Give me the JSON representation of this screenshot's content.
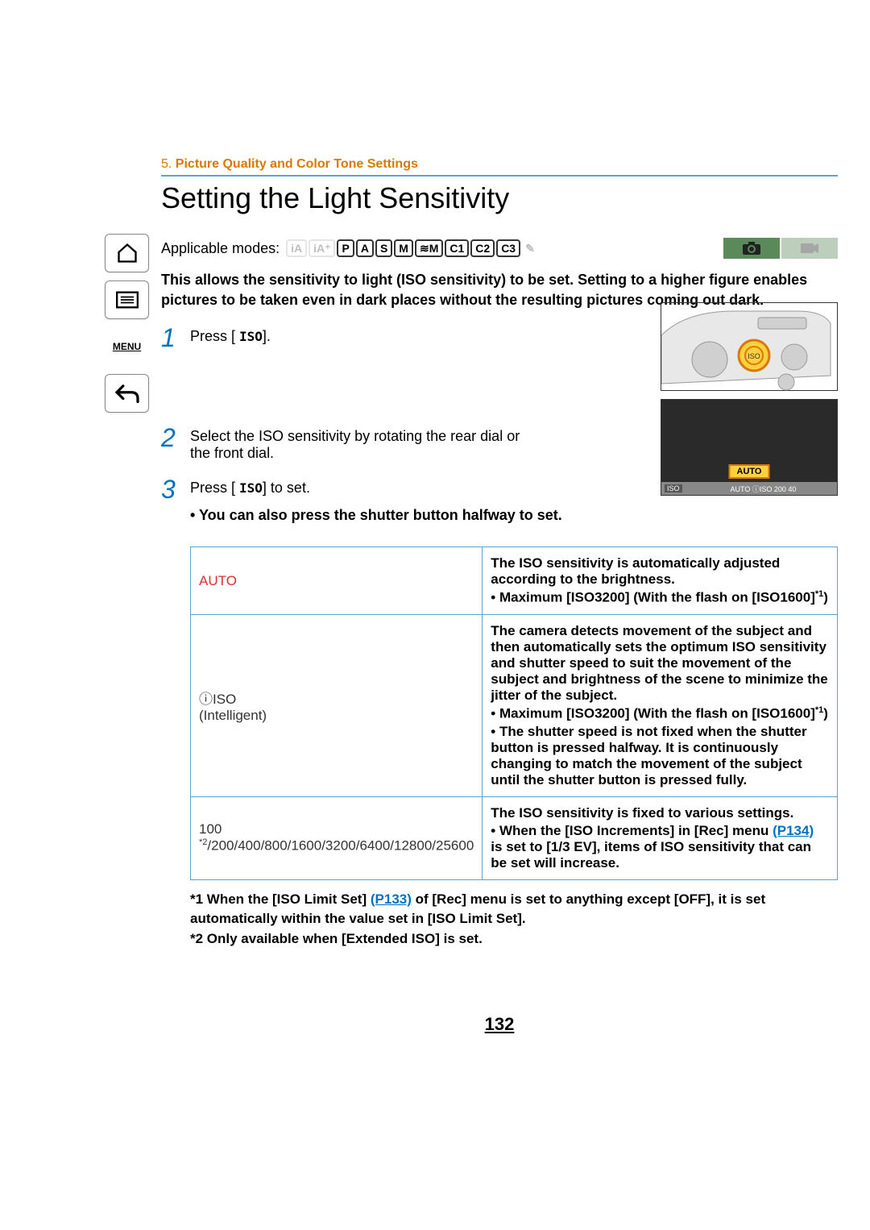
{
  "breadcrumb": {
    "num": "5.",
    "text": "Picture Quality and Color Tone Settings"
  },
  "title": "Setting the Light Sensitivity",
  "modes_label": "Applicable modes:",
  "modes": {
    "greyed_pre": [
      "iA",
      "iA+"
    ],
    "active": [
      "P",
      "A",
      "S",
      "M",
      "≋M",
      "C1",
      "C2",
      "C3"
    ],
    "greyed_post": [
      "☺"
    ]
  },
  "intro": "This allows the sensitivity to light (ISO sensitivity) to be set. Setting to a higher figure enables pictures to be taken even in dark places without the resulting pictures coming out dark.",
  "steps": {
    "s1": {
      "num": "1",
      "text_a": "Press [ ",
      "iso": "ISO",
      "text_b": "]."
    },
    "s2": {
      "num": "2",
      "text": "Select the ISO sensitivity by rotating the rear dial or the front dial."
    },
    "s3": {
      "num": "3",
      "text_a": "Press [ ",
      "iso": "ISO",
      "text_b": "] to set.",
      "sub": "You can also press the shutter button halfway to set."
    }
  },
  "screen": {
    "auto": "AUTO",
    "strip_left": "ISO",
    "strip_right": "AUTO  ⓘISO  200  40"
  },
  "table": {
    "r1": {
      "label": "AUTO",
      "desc": "The ISO sensitivity is automatically adjusted according to the brightness.",
      "b1_a": "Maximum [ISO3200] (With the flash on [ISO1600]",
      "b1_b": ")"
    },
    "r2": {
      "label_icon": "ⓘISO",
      "label_sub": "(Intelligent)",
      "desc": "The camera detects movement of the subject and then automatically sets the optimum ISO sensitivity and shutter speed to suit the movement of the subject and brightness of the scene to minimize the jitter of the subject.",
      "b1_a": "Maximum [ISO3200] (With the flash on [ISO1600]",
      "b1_b": ")",
      "b2": "The shutter speed is not fixed when the shutter button is pressed halfway. It is continuously changing to match the movement of the subject until the shutter button is pressed fully."
    },
    "r3": {
      "label_a": "100 ",
      "label_sup": "*2",
      "label_b": "/200/400/800/1600/3200/6400/12800/25600",
      "desc": "The ISO sensitivity is fixed to various settings.",
      "b1_a": "When the [ISO Increments] in [Rec] menu ",
      "b1_link": "(P134)",
      "b1_b": " is set to [1/3 EV], items of ISO sensitivity that can be set will increase."
    }
  },
  "footnotes": {
    "f1_a": "*1 When the [ISO Limit Set] ",
    "f1_link": "(P133)",
    "f1_b": " of [Rec] menu is set to anything except [OFF], it is set automatically within the value set in [ISO Limit Set].",
    "f2": "*2 Only available when [Extended ISO] is set."
  },
  "page": "132",
  "sidebar": {
    "menu": "MENU"
  }
}
